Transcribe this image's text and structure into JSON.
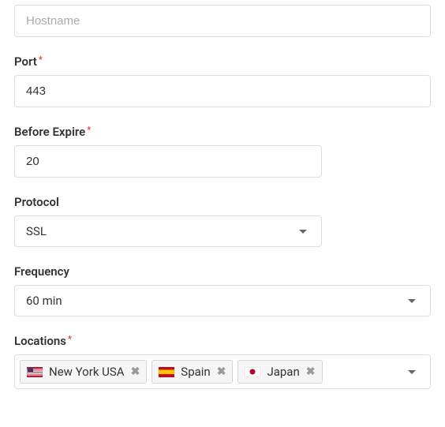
{
  "hostname": {
    "placeholder": "Hostname",
    "value": ""
  },
  "port": {
    "label": "Port",
    "value": "443"
  },
  "before_expire": {
    "label": "Before Expire",
    "value": "20"
  },
  "protocol": {
    "label": "Protocol",
    "selected": "SSL"
  },
  "frequency": {
    "label": "Frequency",
    "selected": "60 min"
  },
  "locations": {
    "label": "Locations",
    "selected": [
      {
        "flag": "us",
        "name": "New York USA"
      },
      {
        "flag": "es",
        "name": "Spain"
      },
      {
        "flag": "jp",
        "name": "Japan"
      }
    ]
  }
}
